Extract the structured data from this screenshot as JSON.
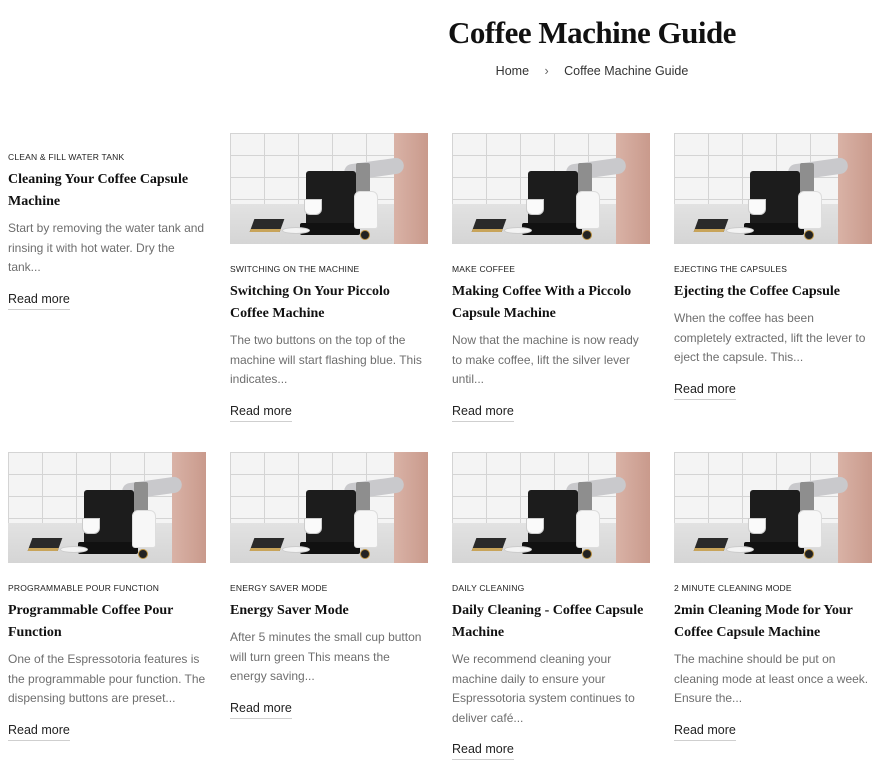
{
  "page": {
    "title": "Coffee Machine Guide"
  },
  "breadcrumb": {
    "home": "Home",
    "separator": "›",
    "current": "Coffee Machine Guide"
  },
  "read_more_label": "Read more",
  "cards": [
    {
      "tag": "CLEAN & FILL WATER TANK",
      "title": "Cleaning Your Coffee Capsule Machine",
      "excerpt": "Start by removing the water tank and rinsing it with hot water. Dry the tank..."
    },
    {
      "tag": "SWITCHING ON THE MACHINE",
      "title": "Switching On Your Piccolo Coffee Machine",
      "excerpt": "The two buttons on the top of the machine will start flashing blue. This indicates..."
    },
    {
      "tag": "MAKE COFFEE",
      "title": "Making Coffee With a Piccolo Capsule Machine",
      "excerpt": "Now that the machine is now ready to make coffee, lift the silver lever until..."
    },
    {
      "tag": "EJECTING THE CAPSULES",
      "title": "Ejecting the Coffee Capsule",
      "excerpt": "When the coffee has been completely extracted, lift the lever to eject the capsule. This..."
    },
    {
      "tag": "PROGRAMMABLE POUR FUNCTION",
      "title": "Programmable Coffee Pour Function",
      "excerpt": "One of the Espressotoria features is the programmable pour function. The dispensing buttons are preset..."
    },
    {
      "tag": "ENERGY SAVER MODE",
      "title": "Energy Saver Mode",
      "excerpt": "After 5 minutes the small cup button will turn green This means the energy saving..."
    },
    {
      "tag": "DAILY CLEANING",
      "title": "Daily Cleaning - Coffee Capsule Machine",
      "excerpt": "We recommend cleaning your machine daily to ensure your Espressotoria system continues to deliver café..."
    },
    {
      "tag": "2 MINUTE CLEANING MODE",
      "title": "2min Cleaning Mode for Your Coffee Capsule Machine",
      "excerpt": "The machine should be put on cleaning mode at least once a week. Ensure the..."
    }
  ]
}
